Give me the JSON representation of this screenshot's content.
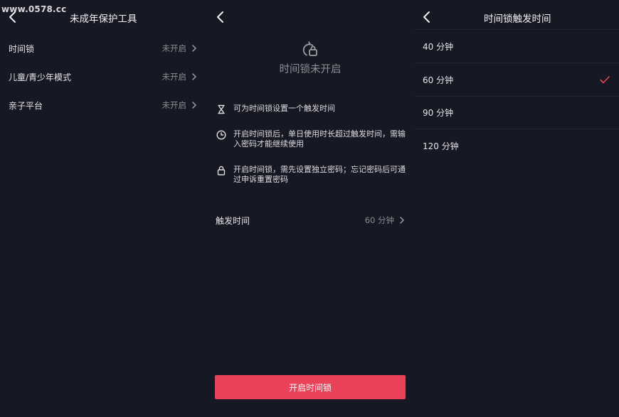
{
  "watermark": "www.0578.cc",
  "colors": {
    "background": "#161823",
    "accent": "#ea4359",
    "muted": "#8a8b91"
  },
  "panel1": {
    "title": "未成年保护工具",
    "items": [
      {
        "label": "时间锁",
        "status": "未开启"
      },
      {
        "label": "儿童/青少年模式",
        "status": "未开启"
      },
      {
        "label": "亲子平台",
        "status": "未开启"
      }
    ]
  },
  "panel2": {
    "heading": "时间锁未开启",
    "info": [
      {
        "icon": "hourglass-icon",
        "text": "可为时间锁设置一个触发时间"
      },
      {
        "icon": "clock-icon",
        "text": "开启时间锁后，单日使用时长超过触发时间，需输入密码才能继续使用"
      },
      {
        "icon": "lock-icon",
        "text": "开启时间锁，需先设置独立密码；忘记密码后可通过申诉重置密码"
      }
    ],
    "trigger": {
      "label": "触发时间",
      "value": "60 分钟"
    },
    "button": "开启时间锁"
  },
  "panel3": {
    "title": "时间锁触发时间",
    "options": [
      {
        "label": "40 分钟",
        "selected": false
      },
      {
        "label": "60 分钟",
        "selected": true
      },
      {
        "label": "90 分钟",
        "selected": false
      },
      {
        "label": "120 分钟",
        "selected": false
      }
    ]
  }
}
